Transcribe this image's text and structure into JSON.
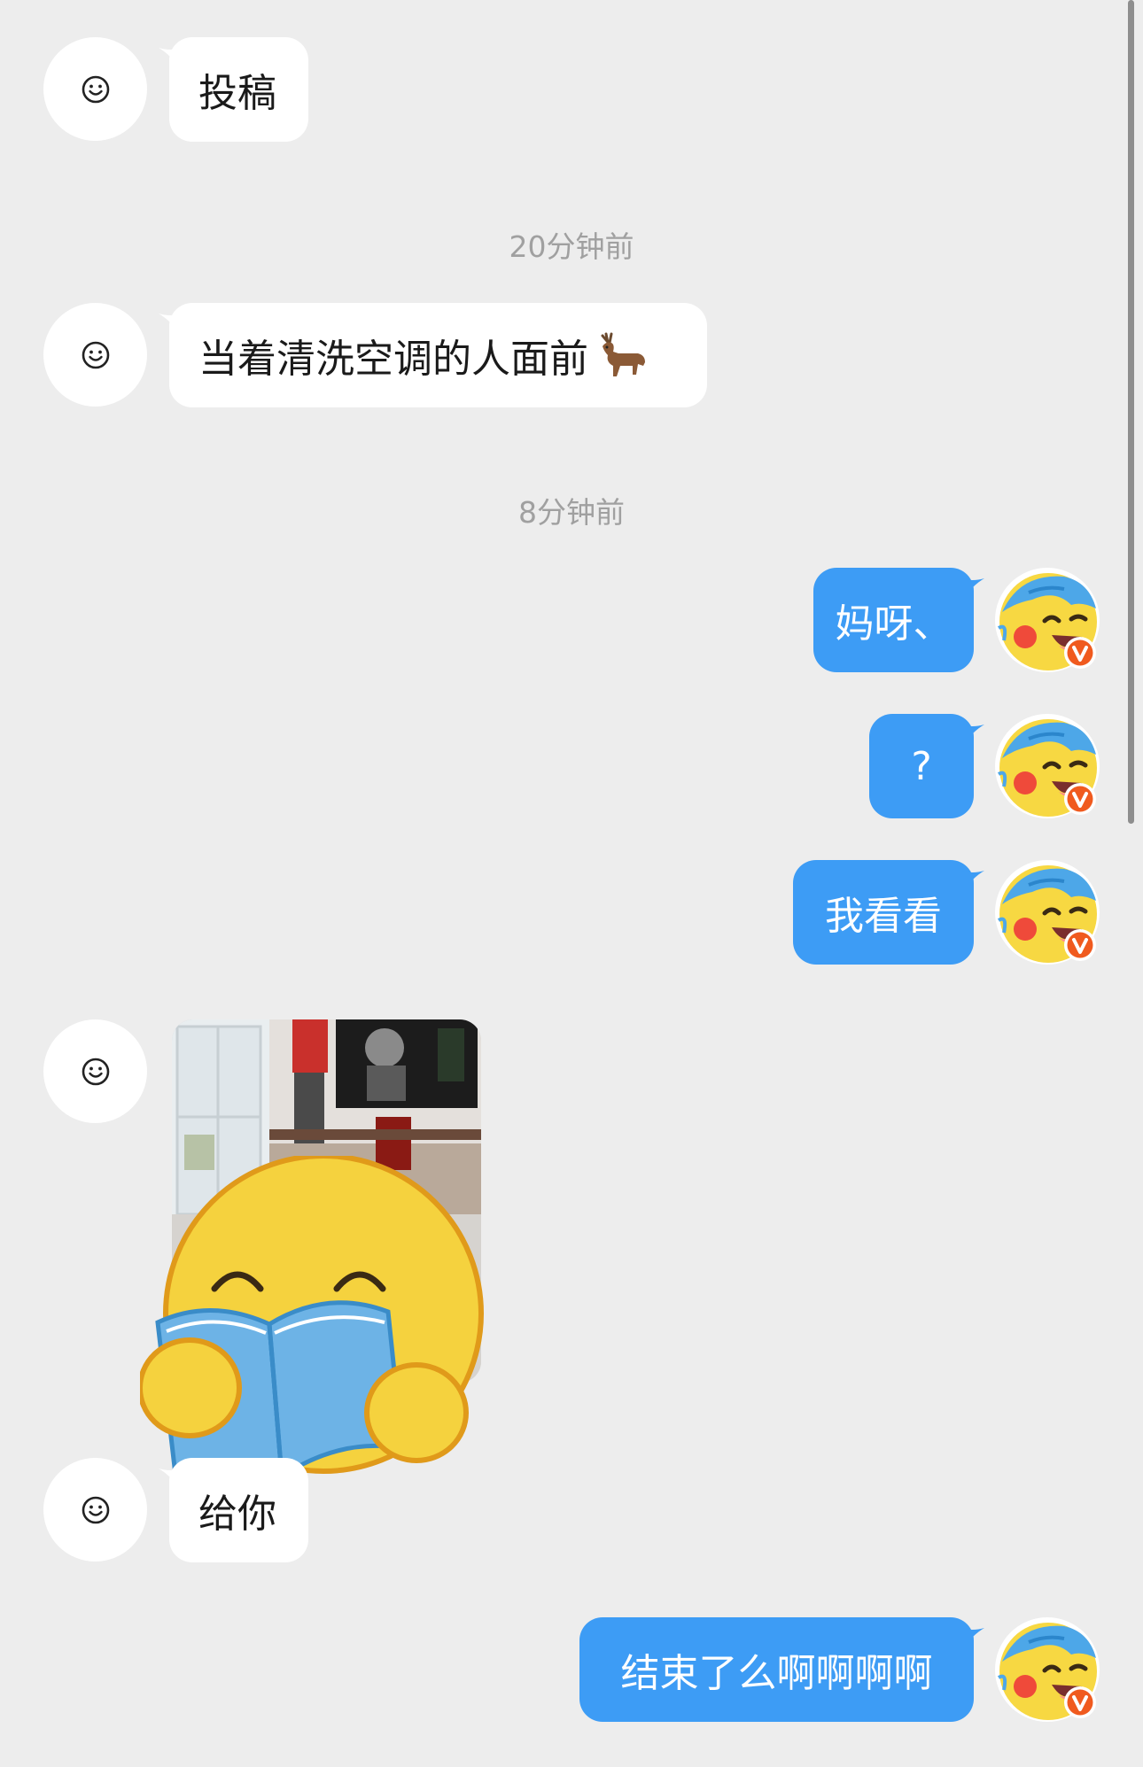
{
  "messages": [
    {
      "text": "投稿"
    },
    {
      "text": "当着清洗空调的人面前"
    },
    {
      "text": "妈呀、"
    },
    {
      "text": "?"
    },
    {
      "text": "我看看"
    },
    {
      "text": "给你"
    },
    {
      "text": "结束了么啊啊啊啊"
    }
  ],
  "timestamps": [
    "20分钟前",
    "8分钟前"
  ],
  "icons": {
    "contact_avatar": "smiley-face-icon",
    "own_avatar": "pikachu-avatar-icon",
    "verified_badge": "v-badge-icon",
    "emoji": "deer-emoji",
    "sticker": "reading-emoji-sticker"
  },
  "colors": {
    "background": "#ededed",
    "incoming_bubble": "#ffffff",
    "outgoing_bubble": "#3d9cf5",
    "timestamp": "#a0a0a0",
    "badge": "#f05a1e"
  }
}
